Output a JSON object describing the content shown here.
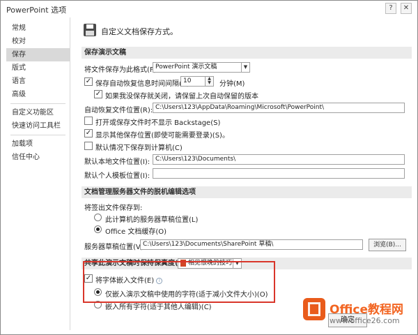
{
  "window": {
    "title": "PowerPoint 选项",
    "help_glyph": "?",
    "close_glyph": "✕"
  },
  "sidebar": {
    "items": [
      "常规",
      "校对",
      "保存",
      "版式",
      "语言",
      "高级",
      "自定义功能区",
      "快速访问工具栏",
      "加载项",
      "信任中心"
    ],
    "selected": "保存"
  },
  "header": {
    "text": "自定义文档保存方式。"
  },
  "save_section": {
    "title": "保存演示文稿",
    "format_label": "将文件保存为此格式(F):",
    "format_value": "PowerPoint 演示文稿",
    "autorecover_label": "保存自动恢复信息时间间隔(A)",
    "autorecover_checked": true,
    "autorecover_minutes": "10",
    "minutes_label": "分钟(M)",
    "keep_last_label": "如果我没保存就关闭，请保留上次自动保留的版本",
    "keep_last_checked": true,
    "autorecover_path_label": "自动恢复文件位置(R):",
    "autorecover_path": "C:\\Users\\123\\AppData\\Roaming\\Microsoft\\PowerPoint\\",
    "backstage_label": "打开或保存文件时不显示 Backstage(S)",
    "backstage_checked": false,
    "other_locations_label": "显示其他保存位置(即使可能需要登录)(S)。",
    "other_locations_checked": true,
    "default_computer_label": "默认情况下保存到计算机(C)",
    "default_computer_checked": false,
    "local_path_label": "默认本地文件位置(I):",
    "local_path": "C:\\Users\\123\\Documents\\",
    "template_label": "默认个人模板位置(I):",
    "template_path": ""
  },
  "offline_section": {
    "title": "文档管理服务器文件的脱机编辑选项",
    "checkout_label": "将签出文件保存到:",
    "option_server_label": "此计算机的服务器草稿位置(L)",
    "option_cache_label": "Office 文档缓存(O)",
    "selected": "cache",
    "drafts_label": "服务器草稿位置(V):",
    "drafts_path": "C:\\Users\\123\\Documents\\SharePoint 草稿\\",
    "browse_button": "浏览(B)..."
  },
  "fidelity_section": {
    "title": "共享此演示文稿时保持保真度(D):",
    "document_value": "相见恨晚的技巧",
    "embed_fonts_label": "将字体嵌入文件(E)",
    "embed_fonts_checked": true,
    "embed_used_label": "仅嵌入演示文稿中使用的字符(适于减小文件大小)(O)",
    "embed_all_label": "嵌入所有字符(适于其他人编辑)(C)",
    "selected": "used"
  },
  "footer": {
    "ok_button": "确定"
  },
  "watermark": {
    "name": "Office教程网",
    "url": "www.office26.com",
    "icon_color": "#e95b1b",
    "text_color": "#f26522"
  },
  "colors": {
    "highlight_border": "#d9352a",
    "section_bg": "#ebebeb",
    "selected_nav_bg": "#d9d9d9"
  }
}
